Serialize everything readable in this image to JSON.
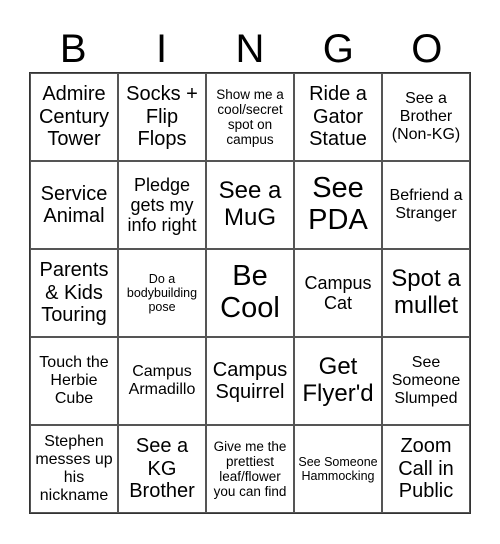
{
  "header": {
    "letters": [
      "B",
      "I",
      "N",
      "G",
      "O"
    ]
  },
  "cells": [
    [
      {
        "text": "Admire Century Tower",
        "size": "s-ml"
      },
      {
        "text": "Socks + Flip Flops",
        "size": "s-ml"
      },
      {
        "text": "Show me a cool/secret spot on campus",
        "size": "s-xs"
      },
      {
        "text": "Ride a Gator Statue",
        "size": "s-ml"
      },
      {
        "text": "See a Brother (Non-KG)",
        "size": "s-s"
      }
    ],
    [
      {
        "text": "Service Animal",
        "size": "s-ml"
      },
      {
        "text": "Pledge gets my info right",
        "size": "s-m"
      },
      {
        "text": "See a MuG",
        "size": "s-l"
      },
      {
        "text": "See PDA",
        "size": "s-xl"
      },
      {
        "text": "Befriend a Stranger",
        "size": "s-s"
      }
    ],
    [
      {
        "text": "Parents & Kids Touring",
        "size": "s-ml"
      },
      {
        "text": "Do a bodybuilding pose",
        "size": "s-xxs"
      },
      {
        "text": "Be Cool",
        "size": "s-xl"
      },
      {
        "text": "Campus Cat",
        "size": "s-m"
      },
      {
        "text": "Spot a mullet",
        "size": "s-l"
      }
    ],
    [
      {
        "text": "Touch the Herbie Cube",
        "size": "s-s"
      },
      {
        "text": "Campus Armadillo",
        "size": "s-s"
      },
      {
        "text": "Campus Squirrel",
        "size": "s-ml"
      },
      {
        "text": "Get Flyer'd",
        "size": "s-l"
      },
      {
        "text": "See Someone Slumped",
        "size": "s-s"
      }
    ],
    [
      {
        "text": "Stephen messes up his nickname",
        "size": "s-s"
      },
      {
        "text": "See a KG Brother",
        "size": "s-ml"
      },
      {
        "text": "Give me the prettiest leaf/flower you can find",
        "size": "s-xs"
      },
      {
        "text": "See Someone Hammocking",
        "size": "s-xxs"
      },
      {
        "text": "Zoom Call in Public",
        "size": "s-ml"
      }
    ]
  ]
}
